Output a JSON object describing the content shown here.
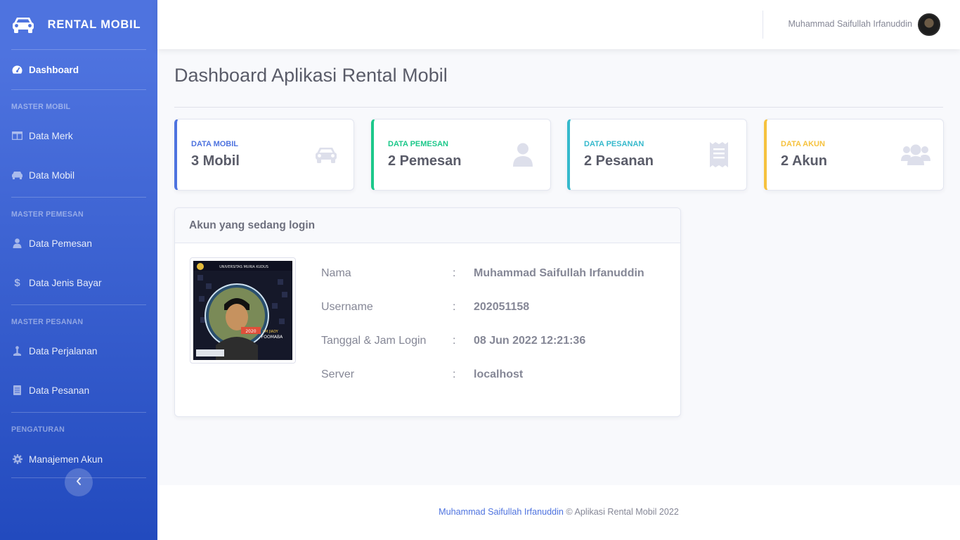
{
  "sidebar": {
    "brand": "RENTAL MOBIL",
    "dashboard": "Dashboard",
    "headings": {
      "master_mobil": "MASTER MOBIL",
      "master_pemesan": "MASTER PEMESAN",
      "master_pesanan": "MASTER PESANAN",
      "pengaturan": "PENGATURAN"
    },
    "items": {
      "data_merk": "Data Merk",
      "data_mobil": "Data Mobil",
      "data_pemesan": "Data Pemesan",
      "data_jenis_bayar": "Data Jenis Bayar",
      "data_perjalanan": "Data Perjalanan",
      "data_pesanan": "Data Pesanan",
      "manajemen_akun": "Manajemen Akun"
    }
  },
  "topbar": {
    "user_name": "Muhammad Saifullah Irfanuddin"
  },
  "page": {
    "title": "Dashboard Aplikasi Rental Mobil"
  },
  "stats": [
    {
      "label": "DATA MOBIL",
      "value": "3 Mobil",
      "color": "#4e73df",
      "icon": "car-icon"
    },
    {
      "label": "DATA PEMESAN",
      "value": "2 Pemesan",
      "color": "#1cc88a",
      "icon": "user-icon"
    },
    {
      "label": "DATA PESANAN",
      "value": "2 Pesanan",
      "color": "#36b9cc",
      "icon": "receipt-icon"
    },
    {
      "label": "DATA AKUN",
      "value": "2 Akun",
      "color": "#f6c23e",
      "icon": "users-icon"
    }
  ],
  "login_card": {
    "title": "Akun yang sedang login",
    "separator": ":",
    "rows": [
      {
        "key": "Nama",
        "value": "Muhammad Saifullah Irfanuddin"
      },
      {
        "key": "Username",
        "value": "202051158"
      },
      {
        "key": "Tanggal & Jam Login",
        "value": "08 Jun 2022 12:21:36"
      },
      {
        "key": "Server",
        "value": "localhost"
      }
    ]
  },
  "footer": {
    "author": "Muhammad Saifullah Irfanuddin",
    "text": "© Aplikasi Rental Mobil 2022"
  }
}
